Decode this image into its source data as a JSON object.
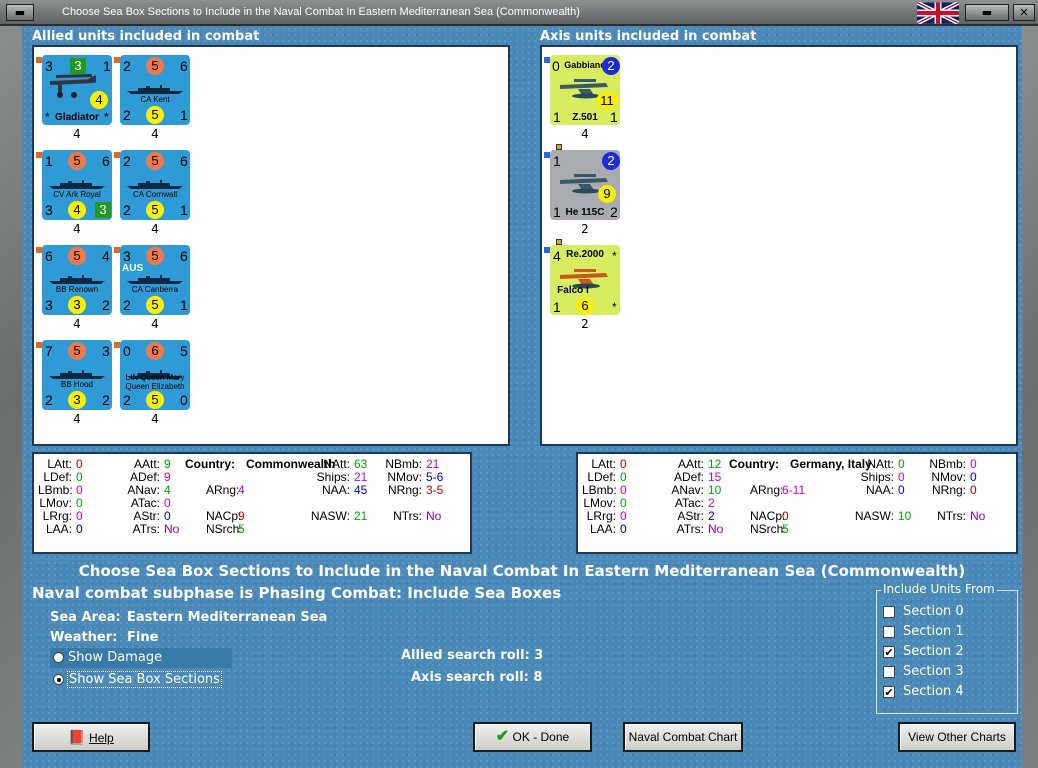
{
  "window": {
    "title": "Choose Sea Box Sections to Include in the Naval Combat In Eastern Mediterranean Sea (Commonwealth)"
  },
  "allied": {
    "heading": "Allied units included in combat",
    "units": [
      {
        "name": "Gladiator",
        "nums": [
          "3",
          "3",
          "1"
        ],
        "circle": "4",
        "count": "4",
        "type": "plane"
      },
      {
        "name": "CA Kent",
        "nums": [
          "2",
          "5",
          "6",
          "2",
          "5",
          "1"
        ],
        "count": "4",
        "type": "ship"
      },
      {
        "name": "CV Ark Royal",
        "nums": [
          "1",
          "5",
          "6",
          "3",
          "4",
          "3"
        ],
        "count": "4",
        "type": "ship"
      },
      {
        "name": "CA Cornwall",
        "nums": [
          "2",
          "5",
          "6",
          "2",
          "5",
          "1"
        ],
        "count": "4",
        "type": "ship"
      },
      {
        "name": "BB Renown",
        "nums": [
          "6",
          "5",
          "4",
          "3",
          "3",
          "2"
        ],
        "count": "4",
        "type": "ship"
      },
      {
        "name": "CA Canberra",
        "nums": [
          "3",
          "5",
          "6",
          "2",
          "5",
          "1"
        ],
        "tag": "AUS",
        "count": "4",
        "type": "ship"
      },
      {
        "name": "BB Hood",
        "nums": [
          "7",
          "5",
          "3",
          "2",
          "3",
          "2"
        ],
        "count": "4",
        "type": "ship"
      },
      {
        "name": "LIN Queen Mary",
        "name2": "Queen Elizabeth",
        "nums": [
          "0",
          "6",
          "5",
          "2",
          "5",
          "0"
        ],
        "count": "4",
        "type": "ship"
      }
    ]
  },
  "axis": {
    "heading": "Axis units included in combat",
    "units": [
      {
        "name": "Gabbiano",
        "sub": "Z.501",
        "nums": [
          "0",
          "2",
          "11",
          "1",
          "1"
        ],
        "count": "4"
      },
      {
        "name": "He 115C",
        "nums": [
          "1",
          "2",
          "9",
          "1",
          "2"
        ],
        "count": "2"
      },
      {
        "name": "Re.2000",
        "sub": "Falco I",
        "nums": [
          "4",
          "*",
          "1",
          "6",
          "*"
        ],
        "count": "2"
      }
    ]
  },
  "allied_stats": {
    "country_label": "Country:",
    "country": "Commonwealth",
    "rows": [
      [
        "LAtt:",
        "0",
        "AAtt:",
        "9",
        "",
        "",
        "NAtt:",
        "63",
        "NBmb:",
        "21"
      ],
      [
        "LDef:",
        "0",
        "ADef:",
        "9",
        "",
        "",
        "Ships:",
        "21",
        "NMov:",
        "5-6"
      ],
      [
        "LBmb:",
        "0",
        "ANav:",
        "4",
        "ARng:",
        "4",
        "NAA:",
        "45",
        "NRng:",
        "3-5"
      ],
      [
        "LMov:",
        "0",
        "ATac:",
        "0",
        "",
        "",
        "",
        "",
        "",
        ""
      ],
      [
        "LRrg:",
        "0",
        "AStr:",
        "0",
        "NACp:",
        "9",
        "NASW:",
        "21",
        "NTrs:",
        "No"
      ],
      [
        "LAA:",
        "0",
        "ATrs:",
        "No",
        "NSrch:",
        "5",
        "",
        "",
        "",
        ""
      ]
    ]
  },
  "axis_stats": {
    "country_label": "Country:",
    "country": "Germany, Italy",
    "rows": [
      [
        "LAtt:",
        "0",
        "AAtt:",
        "12",
        "",
        "",
        "NAtt:",
        "0",
        "NBmb:",
        "0"
      ],
      [
        "LDef:",
        "0",
        "ADef:",
        "15",
        "",
        "",
        "Ships:",
        "0",
        "NMov:",
        "0"
      ],
      [
        "LBmb:",
        "0",
        "ANav:",
        "10",
        "ARng:",
        "6-11",
        "NAA:",
        "0",
        "NRng:",
        "0"
      ],
      [
        "LMov:",
        "0",
        "ATac:",
        "2",
        "",
        "",
        "",
        "",
        "",
        ""
      ],
      [
        "LRrg:",
        "0",
        "AStr:",
        "2",
        "NACp:",
        "0",
        "NASW:",
        "10",
        "NTrs:",
        "No"
      ],
      [
        "LAA:",
        "0",
        "ATrs:",
        "No",
        "NSrch:",
        "5",
        "",
        "",
        "",
        ""
      ]
    ]
  },
  "main_title": "Choose Sea Box Sections to Include in the Naval Combat In Eastern Mediterranean Sea (Commonwealth)",
  "subtitle": "Naval combat subphase is Phasing Combat: Include Sea Boxes",
  "sea_area_label": "Sea Area:",
  "sea_area": "Eastern Mediterranean Sea",
  "weather_label": "Weather:",
  "weather": "Fine",
  "allied_roll": "Allied search roll: 3",
  "axis_roll": "Axis search roll: 8",
  "radio": {
    "damage": "Show Damage",
    "sections": "Show Sea Box Sections"
  },
  "include": {
    "legend": "Include Units From",
    "sections": [
      {
        "label": "Section 0",
        "checked": false
      },
      {
        "label": "Section 1",
        "checked": false
      },
      {
        "label": "Section 2",
        "checked": true
      },
      {
        "label": "Section 3",
        "checked": false
      },
      {
        "label": "Section 4",
        "checked": true
      }
    ]
  },
  "buttons": {
    "help": "Help",
    "ok": "OK - Done",
    "chart": "Naval Combat Chart",
    "other": "View Other Charts"
  },
  "colors": {
    "accent": "#4b8ab8",
    "counter_blue": "#2f9bd6",
    "axis_yellow": "#d8ec60"
  }
}
